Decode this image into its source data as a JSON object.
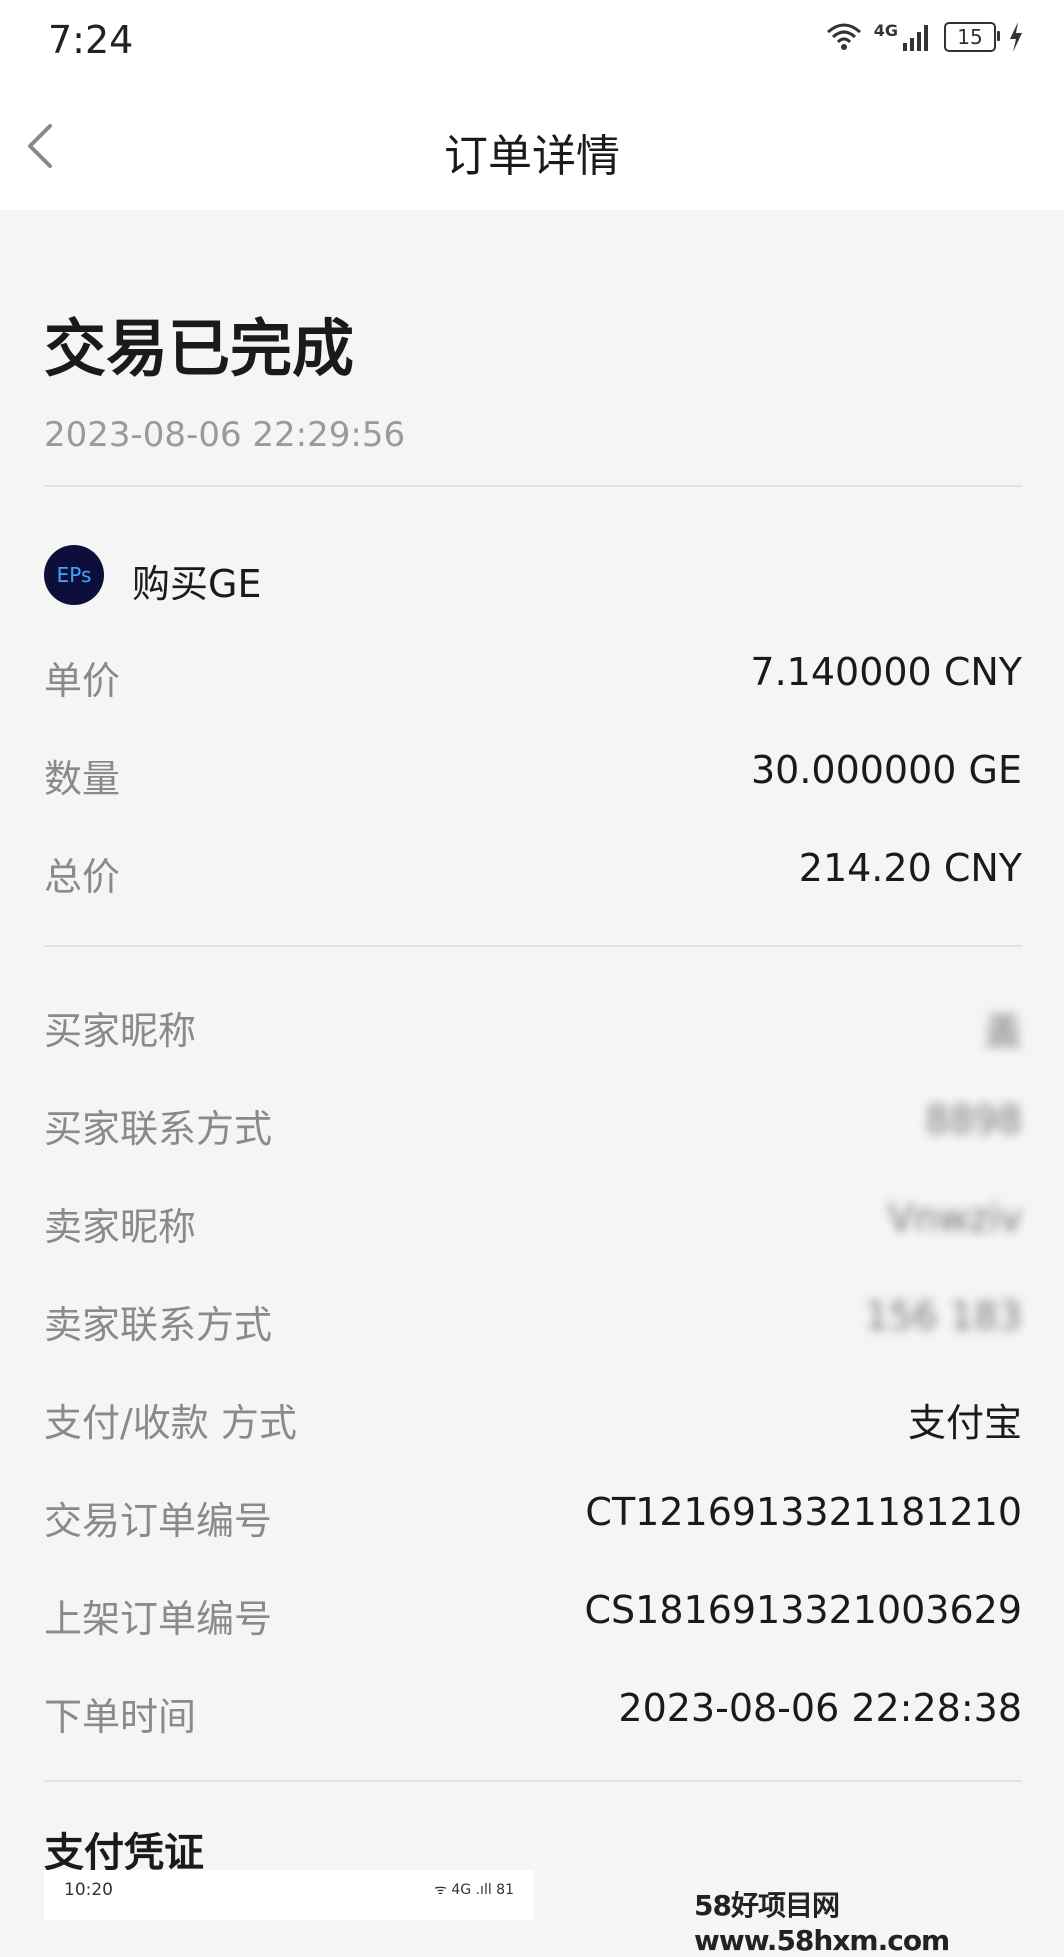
{
  "status_bar": {
    "time": "7:24",
    "network": "4G",
    "battery": "15"
  },
  "nav": {
    "title": "订单详情"
  },
  "order": {
    "status": "交易已完成",
    "status_time": "2023-08-06 22:29:56",
    "product_logo": "EPs",
    "product_name": "购买GE",
    "unit_price_label": "单价",
    "unit_price": "7.140000 CNY",
    "quantity_label": "数量",
    "quantity": "30.000000 GE",
    "total_label": "总价",
    "total": "214.20 CNY"
  },
  "parties": {
    "buyer_name_label": "买家昵称",
    "buyer_name": "盖",
    "buyer_contact_label": "买家联系方式",
    "buyer_contact": "8898",
    "seller_name_label": "卖家昵称",
    "seller_name": "Vnwziv",
    "seller_contact_label": "卖家联系方式",
    "seller_contact": "156 183",
    "payment_label": "支付/收款 方式",
    "payment": "支付宝",
    "trade_no_label": "交易订单编号",
    "trade_no": "CT1216913321181210",
    "listing_no_label": "上架订单编号",
    "listing_no": "CS1816913321003629",
    "order_time_label": "下单时间",
    "order_time": "2023-08-06 22:28:38"
  },
  "voucher": {
    "title": "支付凭证",
    "thumb_time": "10:20",
    "thumb_icons": "ᯤ 4G .ıll 81"
  },
  "watermark": "58好项目网www.58hxm.com"
}
